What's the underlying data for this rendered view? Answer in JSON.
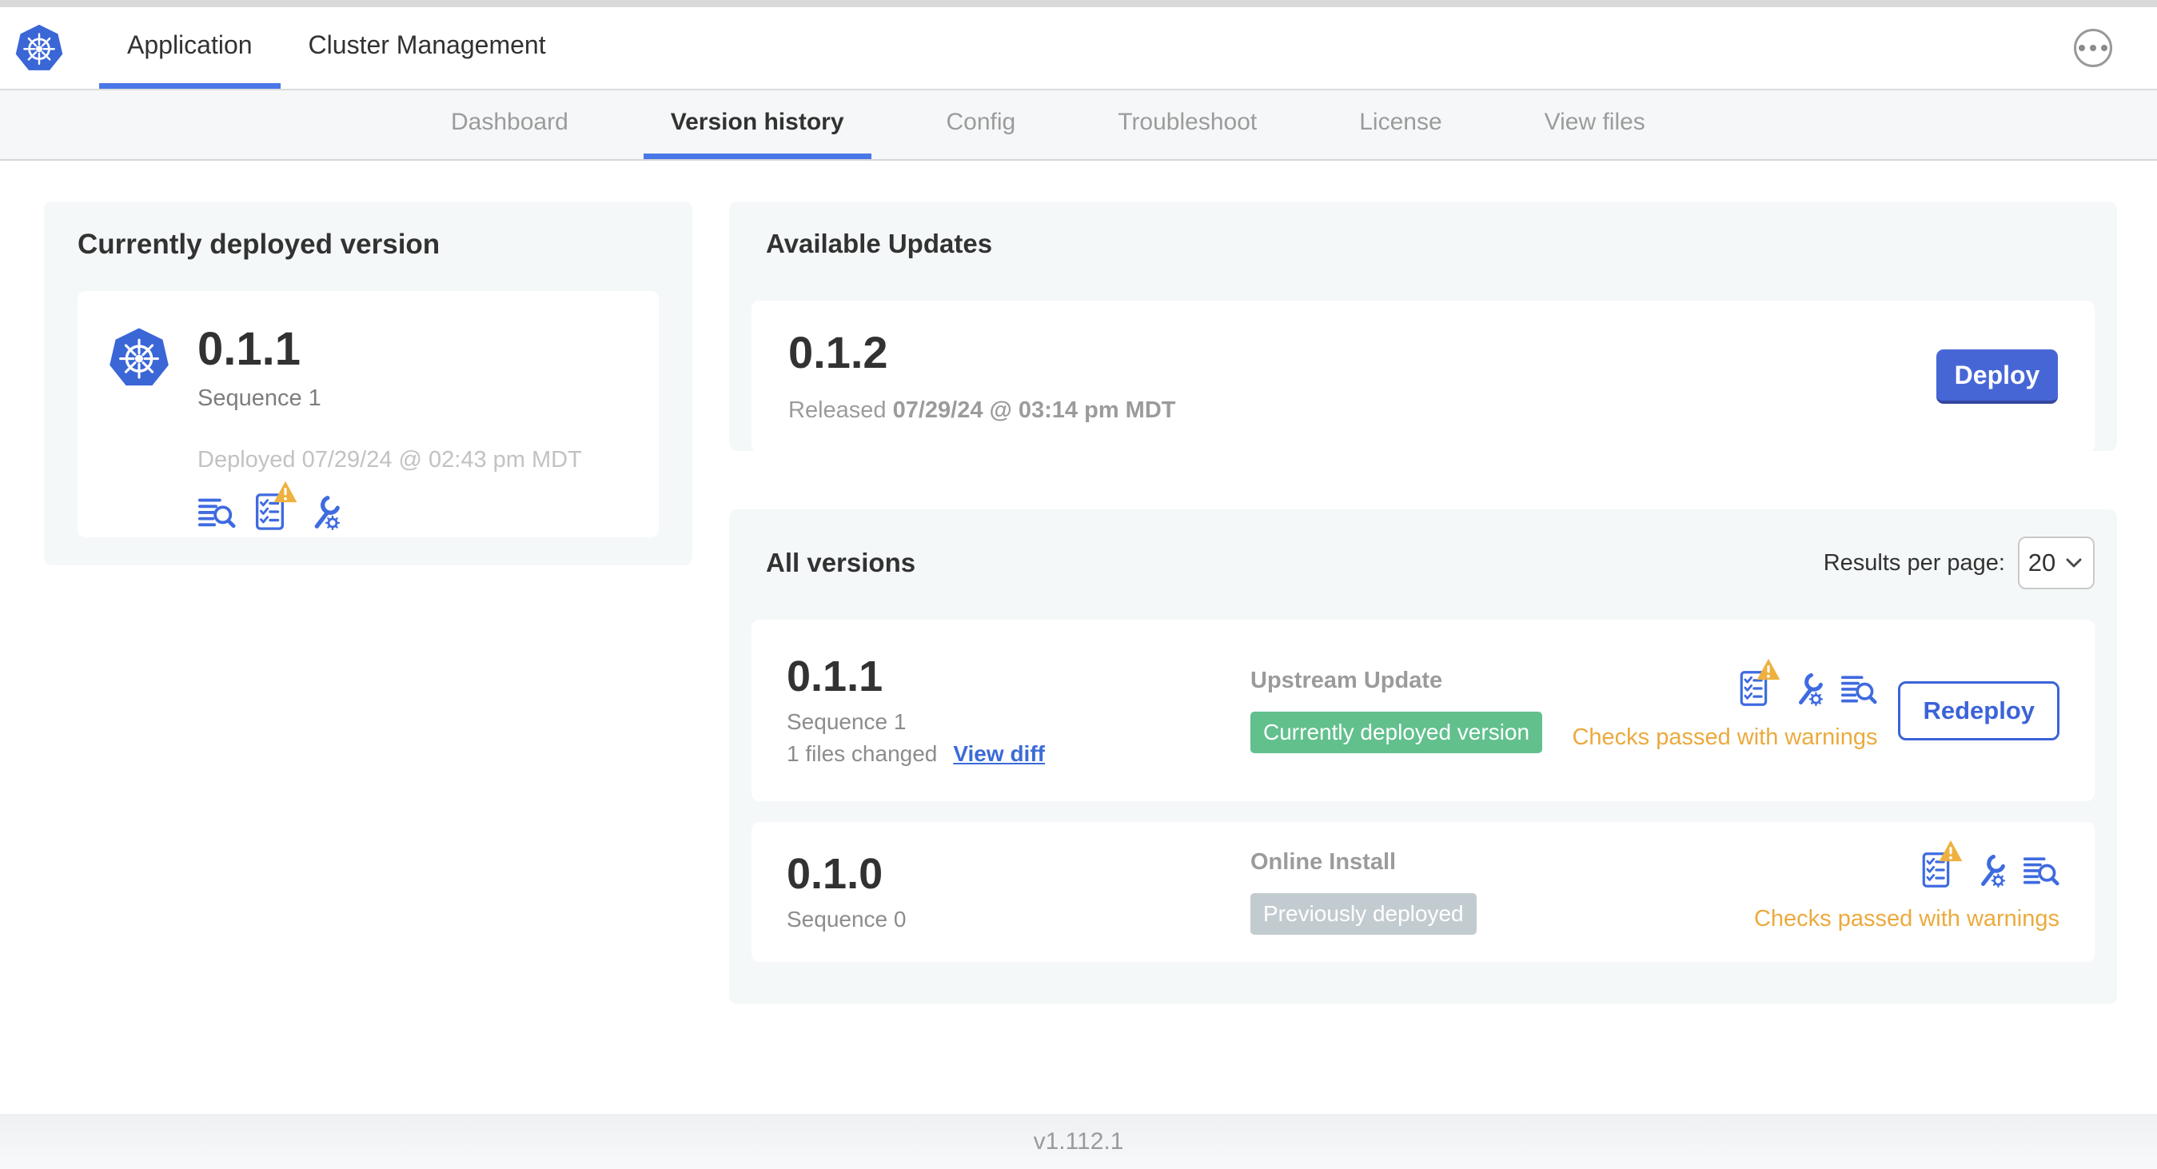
{
  "colors": {
    "accent_blue": "#4a77e8",
    "deploy_button_blue": "#4766d6",
    "icon_blue": "#3f6be0",
    "link_blue": "#3b6bd8",
    "badge_green": "#62c08d",
    "badge_gray": "#c2ccd0",
    "warning_amber": "#ebaa3d",
    "card_gray": "#f5f8f9"
  },
  "header": {
    "logo_icon": "kubernetes-logo",
    "tabs": [
      {
        "label": "Application"
      },
      {
        "label": "Cluster Management"
      }
    ],
    "more_icon": "ellipsis-icon"
  },
  "subnav": {
    "tabs": [
      {
        "label": "Dashboard"
      },
      {
        "label": "Version history"
      },
      {
        "label": "Config"
      },
      {
        "label": "Troubleshoot"
      },
      {
        "label": "License"
      },
      {
        "label": "View files"
      }
    ],
    "active_tab": "Version history"
  },
  "current_version_card": {
    "title": "Currently deployed version",
    "version": "0.1.1",
    "sequence": "Sequence 1",
    "deployed": "Deployed 07/29/24 @ 02:43 pm MDT",
    "icons": [
      "release-notes-icon",
      "preflight-checks-icon",
      "edit-config-icon"
    ]
  },
  "available_updates": {
    "title": "Available Updates",
    "version": "0.1.2",
    "released_prefix": "Released",
    "released_date": "07/29/24 @ 03:14 pm MDT",
    "deploy_label": "Deploy"
  },
  "all_versions": {
    "title": "All versions",
    "results_per_page_label": "Results per page:",
    "results_per_page_value": "20",
    "rows": [
      {
        "version": "0.1.1",
        "sequence": "Sequence 1",
        "files_changed": "1 files changed",
        "view_diff_label": "View diff",
        "source": "Upstream Update",
        "badge": "Currently deployed version",
        "badge_color": "green",
        "checks_status": "Checks passed with warnings",
        "action_label": "Redeploy",
        "icons": [
          "preflight-checks-icon",
          "edit-config-icon",
          "release-notes-icon"
        ]
      },
      {
        "version": "0.1.0",
        "sequence": "Sequence 0",
        "source": "Online Install",
        "badge": "Previously deployed",
        "badge_color": "gray",
        "checks_status": "Checks passed with warnings",
        "icons": [
          "preflight-checks-icon",
          "edit-config-icon",
          "release-notes-icon"
        ]
      }
    ]
  },
  "footer": {
    "app_version": "v1.112.1"
  }
}
